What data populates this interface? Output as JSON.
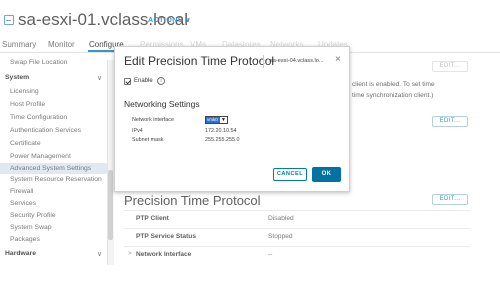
{
  "header": {
    "host_title": "sa-esxi-01.vclass.local",
    "actions_label": "ACTIONS",
    "actions_caret": "∨",
    "tabs": [
      {
        "label": "Summary"
      },
      {
        "label": "Monitor"
      },
      {
        "label": "Configure"
      }
    ],
    "ghost_tabs": [
      "Permissions",
      "VMs",
      "Datastores",
      "Networks",
      "Updates"
    ]
  },
  "sidebar": {
    "items": [
      {
        "label": "Swap File Location",
        "type": "item"
      },
      {
        "label": "System",
        "type": "group"
      },
      {
        "label": "Licensing",
        "type": "item"
      },
      {
        "label": "Host Profile",
        "type": "item"
      },
      {
        "label": "Time Configuration",
        "type": "item",
        "selected": true
      },
      {
        "label": "Authentication Services",
        "type": "item"
      },
      {
        "label": "Certificate",
        "type": "item"
      },
      {
        "label": "Power Management",
        "type": "item"
      },
      {
        "label": "Advanced System Settings",
        "type": "item"
      },
      {
        "label": "System Resource Reservation",
        "type": "item"
      },
      {
        "label": "Firewall",
        "type": "item"
      },
      {
        "label": "Services",
        "type": "item"
      },
      {
        "label": "Security Profile",
        "type": "item"
      },
      {
        "label": "System Swap",
        "type": "item"
      },
      {
        "label": "Packages",
        "type": "item"
      },
      {
        "label": "Hardware",
        "type": "group"
      }
    ],
    "chevron": "∨"
  },
  "content": {
    "edit_label": "EDIT...",
    "bg_line1": "client is enabled. To set time",
    "bg_line2": "time synchronization client.)",
    "ptp_title": "Precision Time Protocol",
    "ptp_rows": [
      {
        "key": "PTP Client",
        "value": "Disabled"
      },
      {
        "key": "PTP Service Status",
        "value": "Stopped"
      },
      {
        "key": "Network Interface",
        "value": "--"
      }
    ],
    "row_chevron": ">"
  },
  "modal": {
    "title": "Edit Precision Time Protocol",
    "host": "sa-esxi-04.vclass.lo...",
    "close_glyph": "×",
    "enable_label": "Enable",
    "info_glyph": "i",
    "networking_title": "Networking Settings",
    "fields": [
      {
        "label": "Network interface",
        "value": "vmk0"
      },
      {
        "label": "IPv4",
        "value": "172.20.10.54"
      },
      {
        "label": "Subnet mask",
        "value": "255.255.255.0"
      }
    ],
    "select_arrow": "▼",
    "cancel_label": "CANCEL",
    "ok_label": "OK"
  }
}
